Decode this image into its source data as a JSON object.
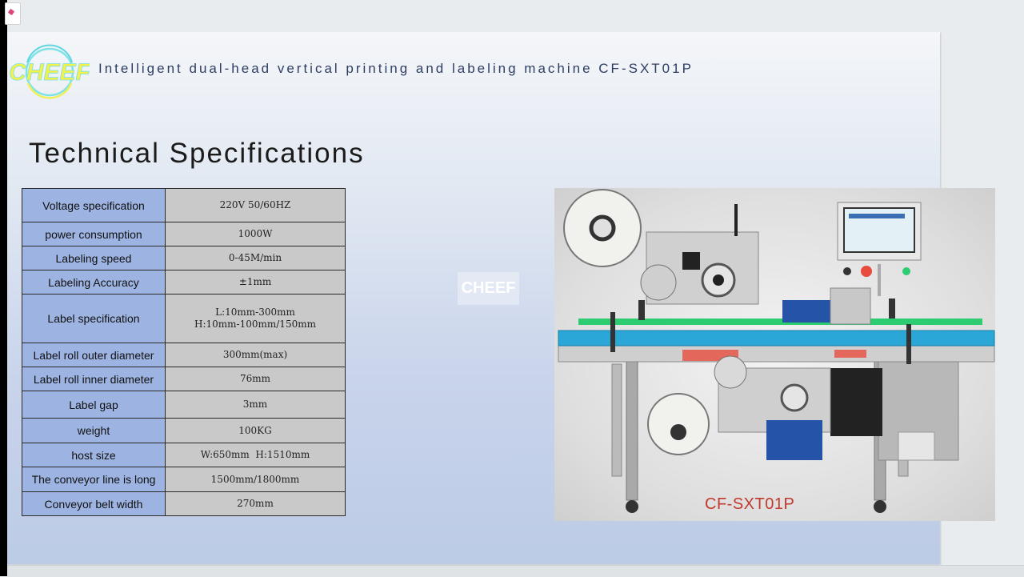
{
  "header": {
    "brand": "CHEEF",
    "title": "Intelligent dual-head vertical printing and labeling machine CF-SXT01P"
  },
  "section_title": "Technical Specifications",
  "specs": [
    {
      "key": "Voltage specification",
      "value": "220V 50/60HZ"
    },
    {
      "key": "power consumption",
      "value": "1000W"
    },
    {
      "key": "Labeling speed",
      "value": "0-45M/min"
    },
    {
      "key": "Labeling Accuracy",
      "value": "±1mm"
    },
    {
      "key": "Label specification",
      "value": "L:10mm-300mm",
      "value2": "H:10mm-100mm/150mm"
    },
    {
      "key": "Label roll outer diameter",
      "value": "300mm(max)"
    },
    {
      "key": "Label roll inner diameter",
      "value": "76mm"
    },
    {
      "key": "Label gap",
      "value": "3mm"
    },
    {
      "key": "weight",
      "value": "100KG"
    },
    {
      "key": "host size",
      "value": "W:650mm  H:1510mm"
    },
    {
      "key": "The conveyor line is long",
      "value": "1500mm/1800mm"
    },
    {
      "key": "Conveyor belt width",
      "value": "270mm"
    }
  ],
  "watermark": "CHEEF",
  "photo": {
    "caption": "CF-SXT01P"
  },
  "colors": {
    "key_cell": "#9db3e2",
    "value_cell": "#c9c9c9",
    "title": "#2e3d62",
    "caption": "#c0392b"
  }
}
